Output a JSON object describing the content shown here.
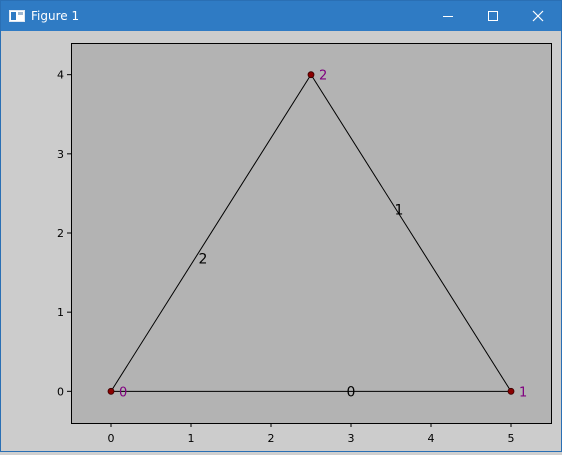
{
  "window": {
    "title": "Figure 1",
    "controls": {
      "minimize_icon": "minimize-icon",
      "maximize_icon": "maximize-icon",
      "close_icon": "close-icon"
    }
  },
  "colors": {
    "titlebar": "#2f7bc4",
    "figure_bg": "#cccccc",
    "axes_bg": "#b3b3b3",
    "node_fill": "#8b0000",
    "node_label": "#800080",
    "edge": "#000000"
  },
  "chart_data": {
    "type": "network",
    "title": "",
    "xlabel": "",
    "ylabel": "",
    "xlim": [
      -0.5,
      5.5
    ],
    "ylim": [
      -0.4,
      4.4
    ],
    "xticks": [
      0,
      1,
      2,
      3,
      4,
      5
    ],
    "yticks": [
      0,
      1,
      2,
      3,
      4
    ],
    "grid": false,
    "nodes": [
      {
        "label": "0",
        "x": 0,
        "y": 0
      },
      {
        "label": "1",
        "x": 5,
        "y": 0
      },
      {
        "label": "2",
        "x": 2.5,
        "y": 4
      }
    ],
    "edges": [
      {
        "label": "0",
        "from": 0,
        "to": 1,
        "label_x": 3,
        "label_y": 0
      },
      {
        "label": "1",
        "from": 1,
        "to": 2,
        "label_x": 3.6,
        "label_y": 2.3
      },
      {
        "label": "2",
        "from": 2,
        "to": 0,
        "label_x": 1.15,
        "label_y": 1.68
      }
    ]
  }
}
